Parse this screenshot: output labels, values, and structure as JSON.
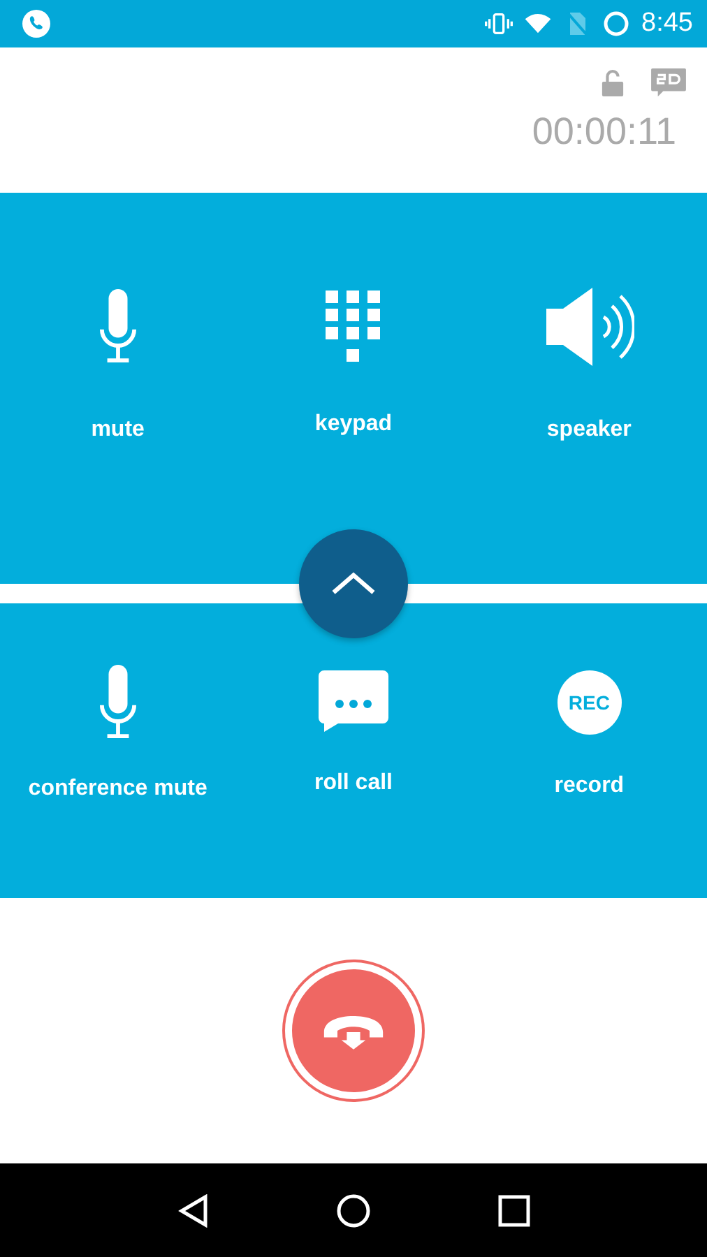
{
  "status_bar": {
    "time": "8:45"
  },
  "call": {
    "timer": "00:00:11"
  },
  "controls_top": [
    {
      "kind": "mic",
      "label": "mute"
    },
    {
      "kind": "keypad",
      "label": "keypad"
    },
    {
      "kind": "speaker",
      "label": "speaker"
    }
  ],
  "controls_bottom": [
    {
      "kind": "mic",
      "label": "conference mute"
    },
    {
      "kind": "chat",
      "label": "roll call"
    },
    {
      "kind": "rec",
      "label": "record",
      "badge": "REC"
    }
  ]
}
